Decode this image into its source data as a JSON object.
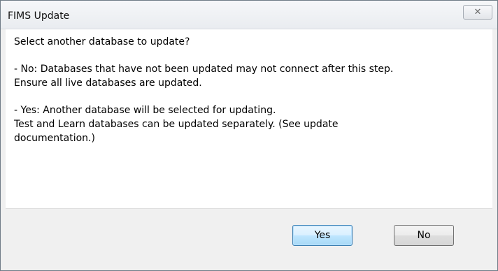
{
  "window": {
    "title": "FIMS Update",
    "close_label": "✕"
  },
  "message": {
    "question": "Select another database to update?",
    "no_line1": "- No: Databases that have not been updated may not connect after this step.",
    "no_line2": "Ensure all live databases are updated.",
    "yes_line1": "- Yes: Another database will be selected for updating.",
    "yes_line2": "Test and Learn databases can be updated separately. (See update",
    "yes_line3": "documentation.)"
  },
  "buttons": {
    "yes_label": "Yes",
    "no_label": "No"
  }
}
